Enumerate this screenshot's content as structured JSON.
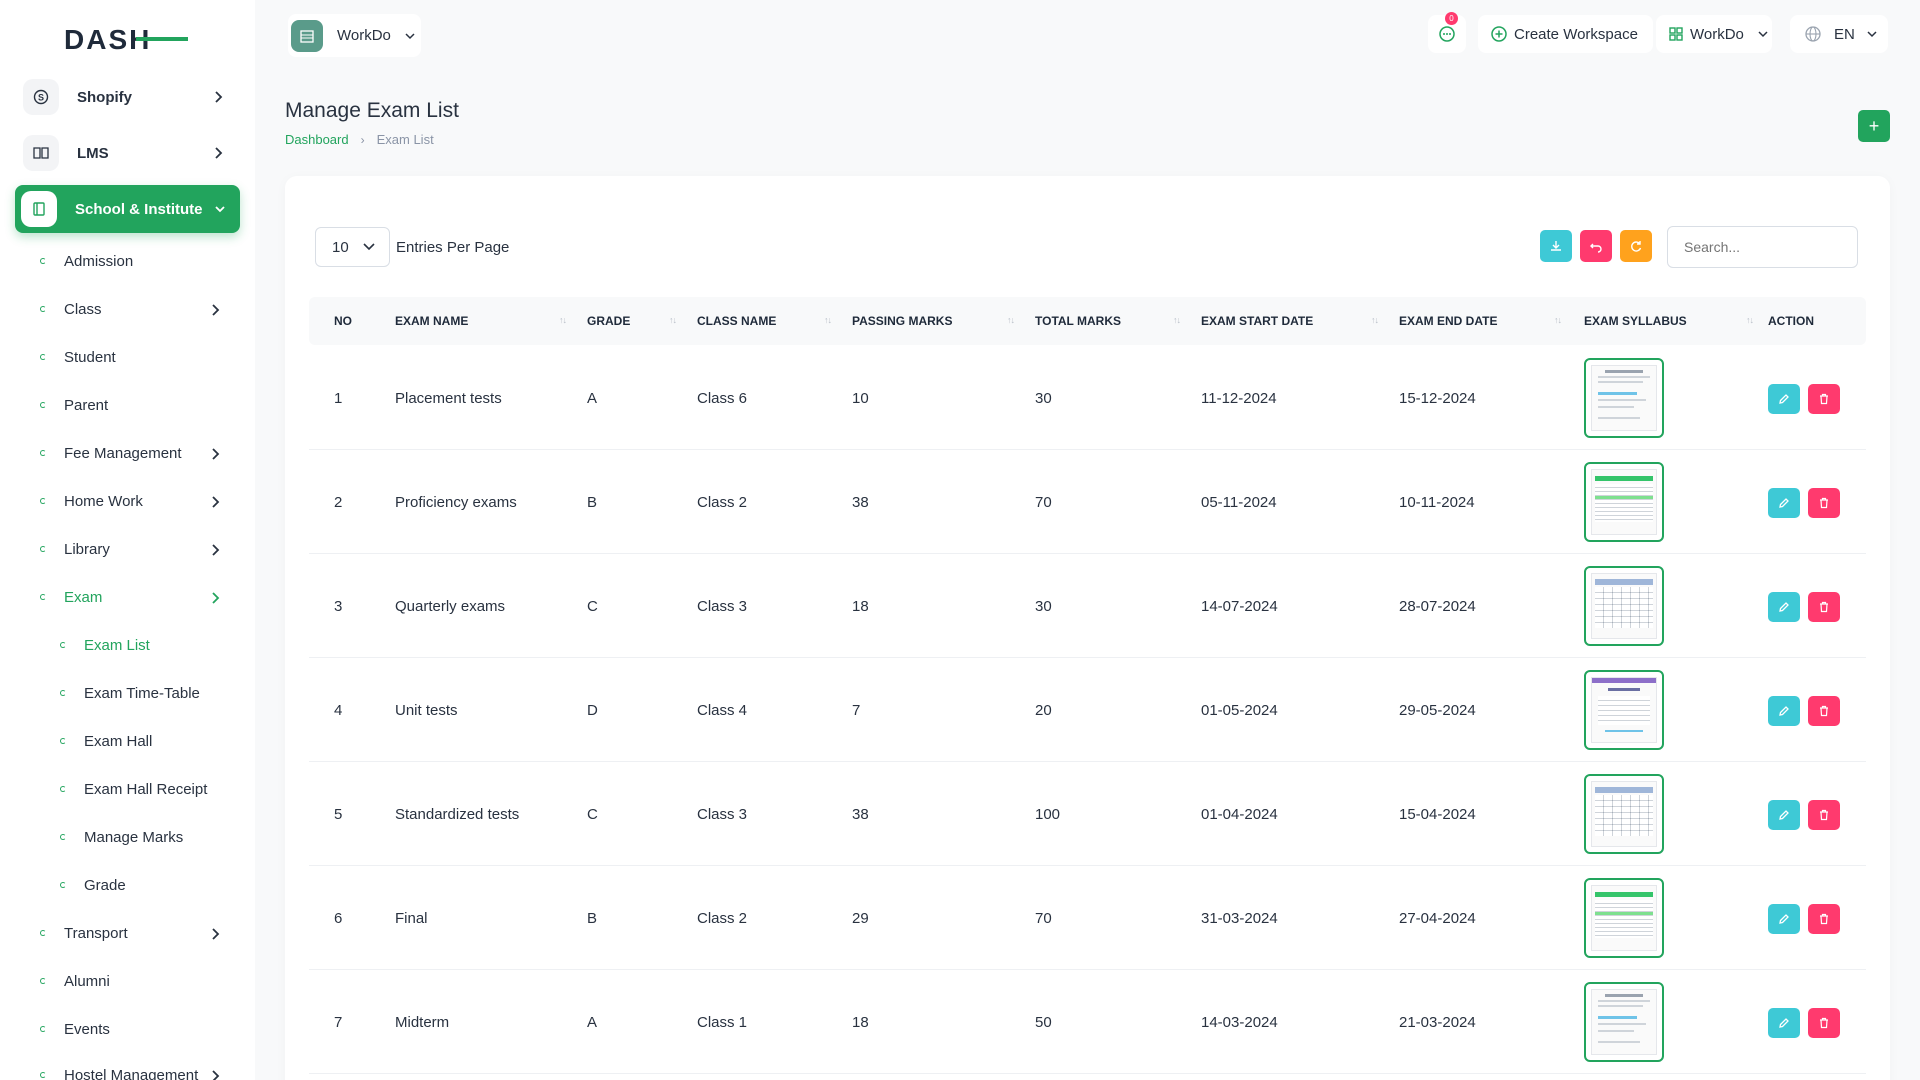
{
  "brand": {
    "logo_text": "DASH"
  },
  "sidebar": {
    "top_items": [
      {
        "label": "Shopify",
        "icon": "shopify-icon"
      },
      {
        "label": "LMS",
        "icon": "book-icon"
      }
    ],
    "active_module": {
      "label": "School & Institute",
      "icon": "school-icon"
    },
    "sub_items": [
      {
        "label": "Admission",
        "has_children": false
      },
      {
        "label": "Class",
        "has_children": true
      },
      {
        "label": "Student",
        "has_children": false
      },
      {
        "label": "Parent",
        "has_children": false
      },
      {
        "label": "Fee Management",
        "has_children": true
      },
      {
        "label": "Home Work",
        "has_children": true
      },
      {
        "label": "Library",
        "has_children": true
      },
      {
        "label": "Exam",
        "has_children": true,
        "open": true
      }
    ],
    "exam_children": [
      {
        "label": "Exam List",
        "current": true
      },
      {
        "label": "Exam Time-Table"
      },
      {
        "label": "Exam Hall"
      },
      {
        "label": "Exam Hall Receipt"
      },
      {
        "label": "Manage Marks"
      },
      {
        "label": "Grade"
      }
    ],
    "bottom_items": [
      {
        "label": "Transport",
        "has_children": true
      },
      {
        "label": "Alumni",
        "has_children": false
      },
      {
        "label": "Events",
        "has_children": false
      },
      {
        "label": "Hostel Management",
        "has_children": true
      }
    ]
  },
  "header": {
    "workspace_label": "WorkDo",
    "notification_count": "0",
    "create_workspace_label": "Create Workspace",
    "user_workspace_label": "WorkDo",
    "language": "EN"
  },
  "page": {
    "title": "Manage Exam List",
    "breadcrumb": [
      "Dashboard",
      "Exam List"
    ],
    "add_button": "+"
  },
  "table_controls": {
    "entries_value": "10",
    "entries_label": "Entries Per Page",
    "search_placeholder": "Search..."
  },
  "colors": {
    "accent": "#22a45d",
    "edit": "#3ec9d6",
    "delete": "#ff3a6e",
    "refresh": "#ffa21d",
    "download": "#3ec9d6"
  },
  "table": {
    "columns": [
      "NO",
      "EXAM NAME",
      "GRADE",
      "CLASS NAME",
      "PASSING MARKS",
      "TOTAL MARKS",
      "EXAM START DATE",
      "EXAM END DATE",
      "EXAM SYLLABUS",
      "ACTION"
    ],
    "rows": [
      {
        "no": "1",
        "name": "Placement tests",
        "grade": "A",
        "class": "Class 6",
        "passing": "10",
        "total": "30",
        "start": "11-12-2024",
        "end": "15-12-2024",
        "syllabus": "doc-a"
      },
      {
        "no": "2",
        "name": "Proficiency exams",
        "grade": "B",
        "class": "Class 2",
        "passing": "38",
        "total": "70",
        "start": "05-11-2024",
        "end": "10-11-2024",
        "syllabus": "doc-b"
      },
      {
        "no": "3",
        "name": "Quarterly exams",
        "grade": "C",
        "class": "Class 3",
        "passing": "18",
        "total": "30",
        "start": "14-07-2024",
        "end": "28-07-2024",
        "syllabus": "doc-c"
      },
      {
        "no": "4",
        "name": "Unit tests",
        "grade": "D",
        "class": "Class 4",
        "passing": "7",
        "total": "20",
        "start": "01-05-2024",
        "end": "29-05-2024",
        "syllabus": "doc-d"
      },
      {
        "no": "5",
        "name": "Standardized tests",
        "grade": "C",
        "class": "Class 3",
        "passing": "38",
        "total": "100",
        "start": "01-04-2024",
        "end": "15-04-2024",
        "syllabus": "doc-c"
      },
      {
        "no": "6",
        "name": "Final",
        "grade": "B",
        "class": "Class 2",
        "passing": "29",
        "total": "70",
        "start": "31-03-2024",
        "end": "27-04-2024",
        "syllabus": "doc-b"
      },
      {
        "no": "7",
        "name": "Midterm",
        "grade": "A",
        "class": "Class 1",
        "passing": "18",
        "total": "50",
        "start": "14-03-2024",
        "end": "21-03-2024",
        "syllabus": "doc-a"
      }
    ]
  }
}
